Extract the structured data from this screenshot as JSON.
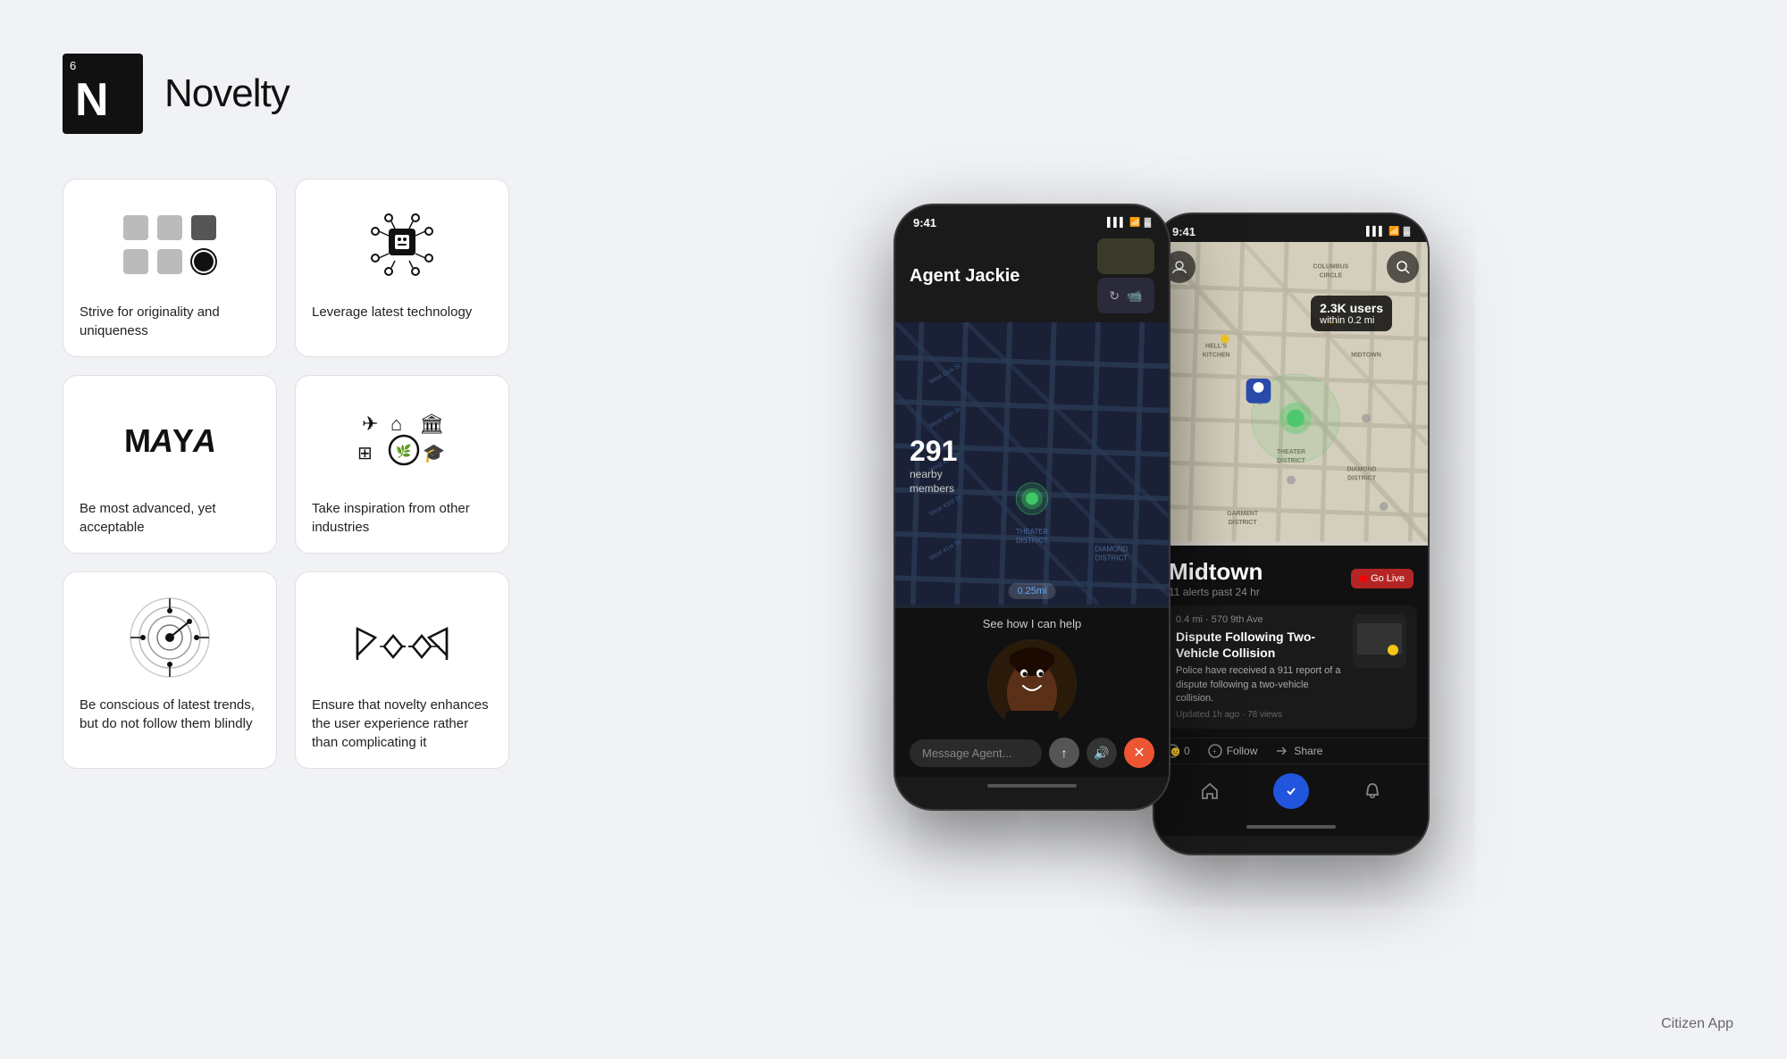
{
  "header": {
    "number": "6",
    "letter": "N",
    "title": "Novelty"
  },
  "cards": [
    {
      "id": "card-originality",
      "label": "Strive for originality and uniqueness"
    },
    {
      "id": "card-technology",
      "label": "Leverage latest technology"
    },
    {
      "id": "card-advanced",
      "label": "Be most advanced, yet acceptable"
    },
    {
      "id": "card-inspiration",
      "label": "Take inspiration from other industries"
    },
    {
      "id": "card-trends",
      "label": "Be conscious of latest trends, but do not follow them blindly"
    },
    {
      "id": "card-enhance",
      "label": "Ensure that novelty enhances the user experience rather than complicating it"
    }
  ],
  "phone1": {
    "time": "9:41",
    "agent_name": "Agent Jackie",
    "nearby_count": "291",
    "nearby_label": "nearby\nmembers",
    "distance": "0.25mi",
    "see_help": "See how I can help",
    "message_placeholder": "Message Agent...",
    "map_label": "THEATER DISTRICT",
    "map_label2": "DIAMOND DISTRICT"
  },
  "phone2": {
    "time": "9:41",
    "location": "Midtown",
    "alerts": "11 alerts past 24 hr",
    "user_badge_count": "2.3K users",
    "user_badge_sub": "within 0.2 mi",
    "go_live": "Go Live",
    "incident_address": "0.4 mi · 570 9th Ave",
    "incident_title": "Dispute Following Two-Vehicle Collision",
    "incident_desc": "Police have received a 911 report of a dispute following a two-vehicle collision.",
    "incident_meta": "Updated 1h ago · 78 views",
    "comments": "0",
    "follow": "Follow",
    "share": "Share",
    "map_areas": [
      "COLUMBUS CIRCLE",
      "HELL'S KITCHEN",
      "MIDTOWN",
      "THEATER DISTRICT",
      "DIAMOND DISTRICT",
      "GARMENT DISTRICT"
    ],
    "citizen_label": "Citizen App"
  }
}
